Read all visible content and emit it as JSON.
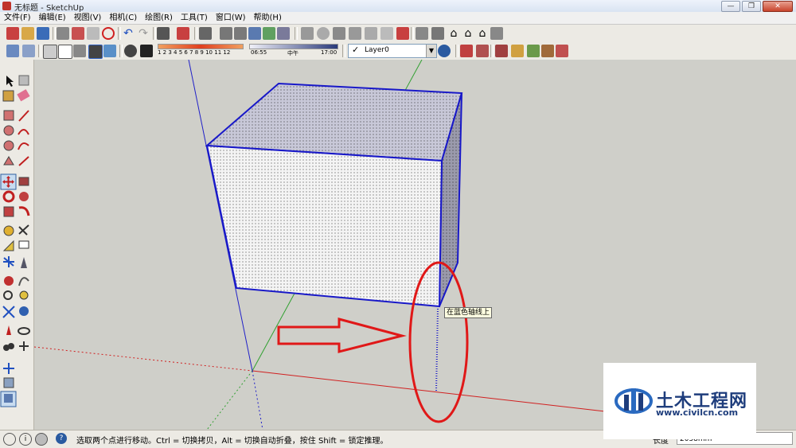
{
  "window": {
    "title": "无标题 - SketchUp",
    "minimize_glyph": "—",
    "restore_glyph": "❐",
    "close_glyph": "✕"
  },
  "menu": [
    "文件(F)",
    "编辑(E)",
    "视图(V)",
    "相机(C)",
    "绘图(R)",
    "工具(T)",
    "窗口(W)",
    "帮助(H)"
  ],
  "toolbar": {
    "shadow_months": "1 2 3 4 5 6 7 8 9 10 11 12",
    "time_start": "06:55",
    "time_mid": "中午",
    "time_end": "17:00",
    "layer": "Layer0",
    "layer_check": "✓"
  },
  "viewport": {
    "tooltip": "在蓝色轴线上",
    "colors": {
      "red_axis": "#d02020",
      "green_axis": "#30a030",
      "blue_axis": "#2020c8",
      "annotation_red": "#e01818"
    }
  },
  "status": {
    "text": "选取两个点进行移动。Ctrl = 切换拷贝，Alt = 切换自动折叠，按住 Shift = 锁定推理。",
    "measure_label": "长度",
    "measure_value": "2058mm",
    "help_glyph": "?"
  },
  "watermark": {
    "cn": "土木工程网",
    "url": "www.civilcn.com"
  }
}
